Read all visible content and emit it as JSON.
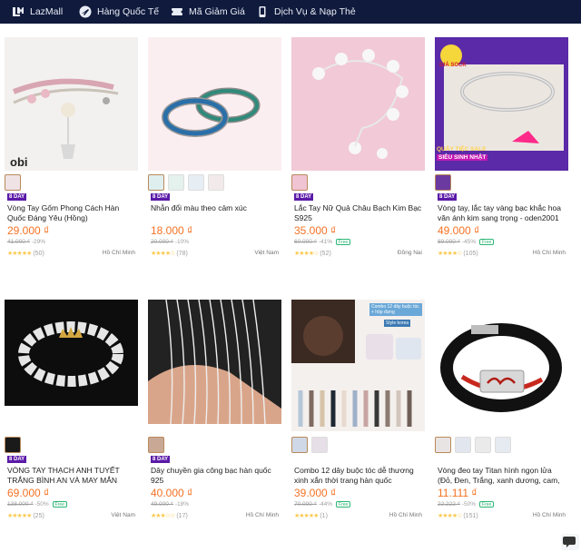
{
  "nav": {
    "lazmall": "LazMall",
    "global": "Hàng Quốc Tế",
    "voucher": "Mã Giảm Giá",
    "topup": "Dịch Vụ & Nạp Thẻ"
  },
  "colors": {
    "nav_bg": "#0f1a3c",
    "price": "#f57224",
    "star": "#faca51",
    "badge": "#5b1aa8"
  },
  "products": [
    {
      "title": "Vòng Tay Gốm Phong Cách Hàn Quốc Đáng Yêu (Hồng)",
      "badge": "8 DAY",
      "price": "29.000 ₫",
      "original": "41.000 ₫",
      "discount": "-29%",
      "free_ship": "",
      "stars": 5,
      "reviews": "(50)",
      "location": "Hồ Chí Minh",
      "image_text": "obi",
      "thumb_count": 1
    },
    {
      "title": "Nhẫn đổi màu theo cảm xúc",
      "badge": "8 DAY",
      "price": "18.000 ₫",
      "original": "20.000 ₫",
      "discount": "-10%",
      "free_ship": "",
      "stars": 4.5,
      "reviews": "(78)",
      "location": "Việt Nam",
      "image_text": "",
      "thumb_count": 4
    },
    {
      "title": "Lắc Tay Nữ Quả Châu Bạch Kim Bạc S925",
      "badge": "8 DAY",
      "price": "35.000 ₫",
      "original": "60.000 ₫",
      "discount": "-41%",
      "free_ship": "Free",
      "stars": 4,
      "reviews": "(52)",
      "location": "Đồng Nai",
      "image_text": "",
      "thumb_count": 1
    },
    {
      "title": "Vòng tay, lắc tay vàng bạc khắc hoa văn ánh kim sang trọng - oden2001",
      "badge": "8 DAY",
      "price": "49.000 ₫",
      "original": "89.000 ₫",
      "discount": "-45%",
      "free_ship": "Free",
      "stars": 4.5,
      "reviews": "(105)",
      "location": "Hồ Chí Minh",
      "image_text": "",
      "thumb_count": 1
    },
    {
      "title": "VÒNG TAY THẠCH ANH TUYẾT TRẮNG BÌNH AN VÀ MAY MẮN",
      "badge": "8 DAY",
      "price": "69.000 ₫",
      "original": "138.000 ₫",
      "discount": "-50%",
      "free_ship": "Free",
      "stars": 5,
      "reviews": "(25)",
      "location": "Việt Nam",
      "image_text": "",
      "thumb_count": 1
    },
    {
      "title": "Dây chuyền gia công bạc hàn quốc 925",
      "badge": "8 DAY",
      "price": "40.000 ₫",
      "original": "49.000 ₫",
      "discount": "-18%",
      "free_ship": "",
      "stars": 3.5,
      "reviews": "(17)",
      "location": "Hồ Chí Minh",
      "image_text": "",
      "thumb_count": 1
    },
    {
      "title": "Combo 12 dây buộc tóc dễ thương xinh xắn thời trang hàn quốc",
      "badge": "",
      "price": "39.000 ₫",
      "original": "70.000 ₫",
      "discount": "-44%",
      "free_ship": "Free",
      "stars": 5,
      "reviews": "(1)",
      "location": "Hồ Chí Minh",
      "image_text": "",
      "thumb_count": 2
    },
    {
      "title": "Vòng đeo tay Titan hình ngọn lửa (Đỏ, Đen, Trắng, xanh dương, cam, xanh...",
      "badge": "",
      "price": "11.111 ₫",
      "original": "22.222 ₫",
      "discount": "-50%",
      "free_ship": "Free",
      "stars": 4,
      "reviews": "(151)",
      "location": "Hồ Chí Minh",
      "image_text": "",
      "thumb_count": 4
    }
  ],
  "promo": {
    "tag": "GIÁ SOCK",
    "line1": "QUẢY TIỆC SALE",
    "line2": "SIÊU SINH NHẬT",
    "box": "Combo 12 dây buộc tóc + hộp đựng",
    "box_sub": "Style korea"
  }
}
